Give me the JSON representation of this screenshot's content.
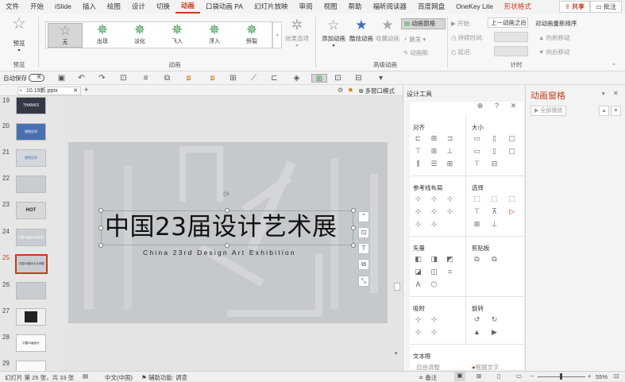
{
  "menubar": {
    "items": [
      "文件",
      "开始",
      "iSlide",
      "插入",
      "绘图",
      "设计",
      "切换",
      "动画",
      "口袋动画 PA",
      "幻灯片放映",
      "审阅",
      "视图",
      "帮助",
      "福昕阅读器",
      "百度网盘",
      "OneKey Lite",
      "形状格式"
    ],
    "active": "动画",
    "share": "共享",
    "comment": "批注"
  },
  "ribbon": {
    "preview_label": "预览",
    "preview_group": "预览",
    "anim_group": "动画",
    "advanced_group": "高级动画",
    "timing_group": "计时",
    "animations": [
      "无",
      "出现",
      "淡化",
      "飞入",
      "浮入",
      "劈裂"
    ],
    "effect_options": "效果选项",
    "add_anim": "添加动画",
    "cool_anim": "酷炫动画",
    "collect_anim": "收藏动画",
    "anim_pane_btn": "动画窗格",
    "trigger": "触发",
    "anim_brush": "动画刷",
    "start_label": "开始:",
    "start_value": "上一动画之后",
    "duration_label": "持续时间:",
    "delay_label": "延迟:",
    "reorder": "对动画重新排序",
    "move_earlier": "向前移动",
    "move_later": "向后移动"
  },
  "toolbar": {
    "autosave": "自动保存",
    "autosave_state": "关"
  },
  "tabbar": {
    "file_tab": "10.19新.pptx",
    "multi_window": "多窗口模式"
  },
  "thumbnails": {
    "numbers": [
      "19",
      "20",
      "21",
      "22",
      "23",
      "24",
      "25",
      "26",
      "27",
      "28",
      "29"
    ],
    "current": "25",
    "texts": [
      "THANKS",
      "规划空间",
      "规划空间",
      "",
      "HOT",
      "中国23届设计艺术展",
      "中国23届设计艺术展",
      "",
      "",
      "",
      "中国23届设计",
      "",
      ""
    ]
  },
  "slide": {
    "title": "中国23届设计艺术展",
    "subtitle": "China 23rd Design Art Exhibition"
  },
  "design_panel": {
    "title": "设计工具",
    "sections": [
      "对齐",
      "大小",
      "参考线布局",
      "选择",
      "矢量",
      "剪贴板",
      "吸附",
      "旋转",
      "文本框"
    ],
    "bottom_left": "自由调整",
    "bottom_right": "根据文字"
  },
  "anim_pane": {
    "title": "动画窗格",
    "play_all": "全部播放"
  },
  "statusbar": {
    "slide_info": "幻灯片 第 25 张，共 33 张",
    "language": "中文(中国)",
    "accessibility": "辅助功能: 调查",
    "notes": "备注",
    "zoom": "55%"
  },
  "colors": {
    "accent": "#c43e1c",
    "green": "#3a9a4a"
  }
}
